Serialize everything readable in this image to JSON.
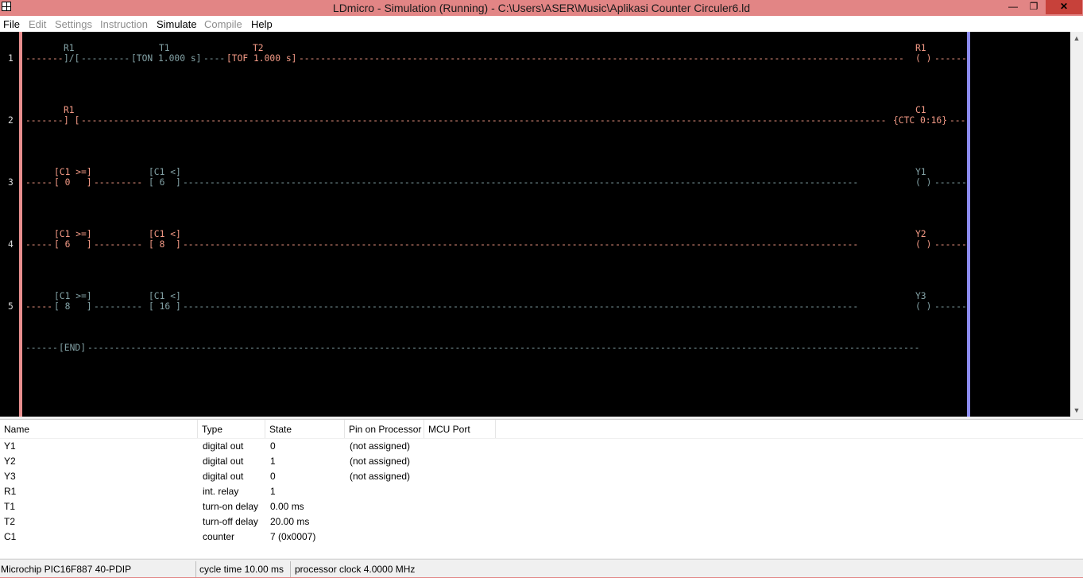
{
  "window": {
    "title": "LDmicro - Simulation (Running) - C:\\Users\\ASER\\Music\\Aplikasi Counter Circuler6.ld",
    "minimize_glyph": "—",
    "maximize_glyph": "❐",
    "close_glyph": "✕"
  },
  "menu": [
    {
      "label": "File",
      "enabled": true
    },
    {
      "label": "Edit",
      "enabled": false
    },
    {
      "label": "Settings",
      "enabled": false
    },
    {
      "label": "Instruction",
      "enabled": false
    },
    {
      "label": "Simulate",
      "enabled": true
    },
    {
      "label": "Compile",
      "enabled": false
    },
    {
      "label": "Help",
      "enabled": true
    }
  ],
  "colors": {
    "energized": "#f49a86",
    "de_energized": "#83a2a6",
    "left_rail": "#e88e8e",
    "right_rail": "#8c8cee",
    "titlebar": "#e28585"
  },
  "ladder": {
    "rungs": [
      {
        "number": "1",
        "elements": [
          {
            "id": "r1-contact",
            "label": "R1",
            "body": "]/[",
            "state": "off"
          },
          {
            "id": "t1-ton",
            "label": "T1",
            "body": "[TON 1.000 s]",
            "state": "off"
          },
          {
            "id": "t2-tof",
            "label": "T2",
            "body": "[TOF 1.000 s]",
            "state": "on"
          },
          {
            "id": "r1-coil",
            "label": "R1",
            "body": "( )",
            "state": "on"
          }
        ]
      },
      {
        "number": "2",
        "elements": [
          {
            "id": "r1-contact",
            "label": "R1",
            "body": "] [",
            "state": "on"
          },
          {
            "id": "c1-ctc",
            "label": "C1",
            "body": "{CTC 0:16}",
            "state": "on"
          }
        ]
      },
      {
        "number": "3",
        "elements": [
          {
            "id": "cmp-ge",
            "label": "[C1 >=]",
            "body": "[ 0   ]",
            "state": "on"
          },
          {
            "id": "cmp-lt",
            "label": "[C1 <]",
            "body": "[ 6  ]",
            "state": "off"
          },
          {
            "id": "y1-coil",
            "label": "Y1",
            "body": "( )",
            "state": "off"
          }
        ]
      },
      {
        "number": "4",
        "elements": [
          {
            "id": "cmp-ge",
            "label": "[C1 >=]",
            "body": "[ 6   ]",
            "state": "on"
          },
          {
            "id": "cmp-lt",
            "label": "[C1 <]",
            "body": "[ 8  ]",
            "state": "on"
          },
          {
            "id": "y2-coil",
            "label": "Y2",
            "body": "( )",
            "state": "on"
          }
        ]
      },
      {
        "number": "5",
        "elements": [
          {
            "id": "cmp-ge",
            "label": "[C1 >=]",
            "body": "[ 8   ]",
            "state": "off"
          },
          {
            "id": "cmp-lt",
            "label": "[C1 <]",
            "body": "[ 16 ]",
            "state": "off"
          },
          {
            "id": "y3-coil",
            "label": "Y3",
            "body": "( )",
            "state": "off"
          }
        ]
      }
    ],
    "end_label": "[END]"
  },
  "io_list": {
    "columns": [
      "Name",
      "Type",
      "State",
      "Pin on Processor",
      "MCU Port"
    ],
    "rows": [
      {
        "name": "Y1",
        "type": "digital out",
        "state": "0",
        "pin": "(not assigned)",
        "port": ""
      },
      {
        "name": "Y2",
        "type": "digital out",
        "state": "1",
        "pin": "(not assigned)",
        "port": ""
      },
      {
        "name": "Y3",
        "type": "digital out",
        "state": "0",
        "pin": "(not assigned)",
        "port": ""
      },
      {
        "name": "R1",
        "type": "int. relay",
        "state": "1",
        "pin": "",
        "port": ""
      },
      {
        "name": "T1",
        "type": "turn-on delay",
        "state": "0.00 ms",
        "pin": "",
        "port": ""
      },
      {
        "name": "T2",
        "type": "turn-off delay",
        "state": "20.00 ms",
        "pin": "",
        "port": ""
      },
      {
        "name": "C1",
        "type": "counter",
        "state": "7 (0x0007)",
        "pin": "",
        "port": ""
      }
    ]
  },
  "status": {
    "mcu": "Microchip PIC16F887 40-PDIP",
    "cycle": "cycle time 10.00 ms",
    "clock": "processor clock 4.0000 MHz"
  }
}
